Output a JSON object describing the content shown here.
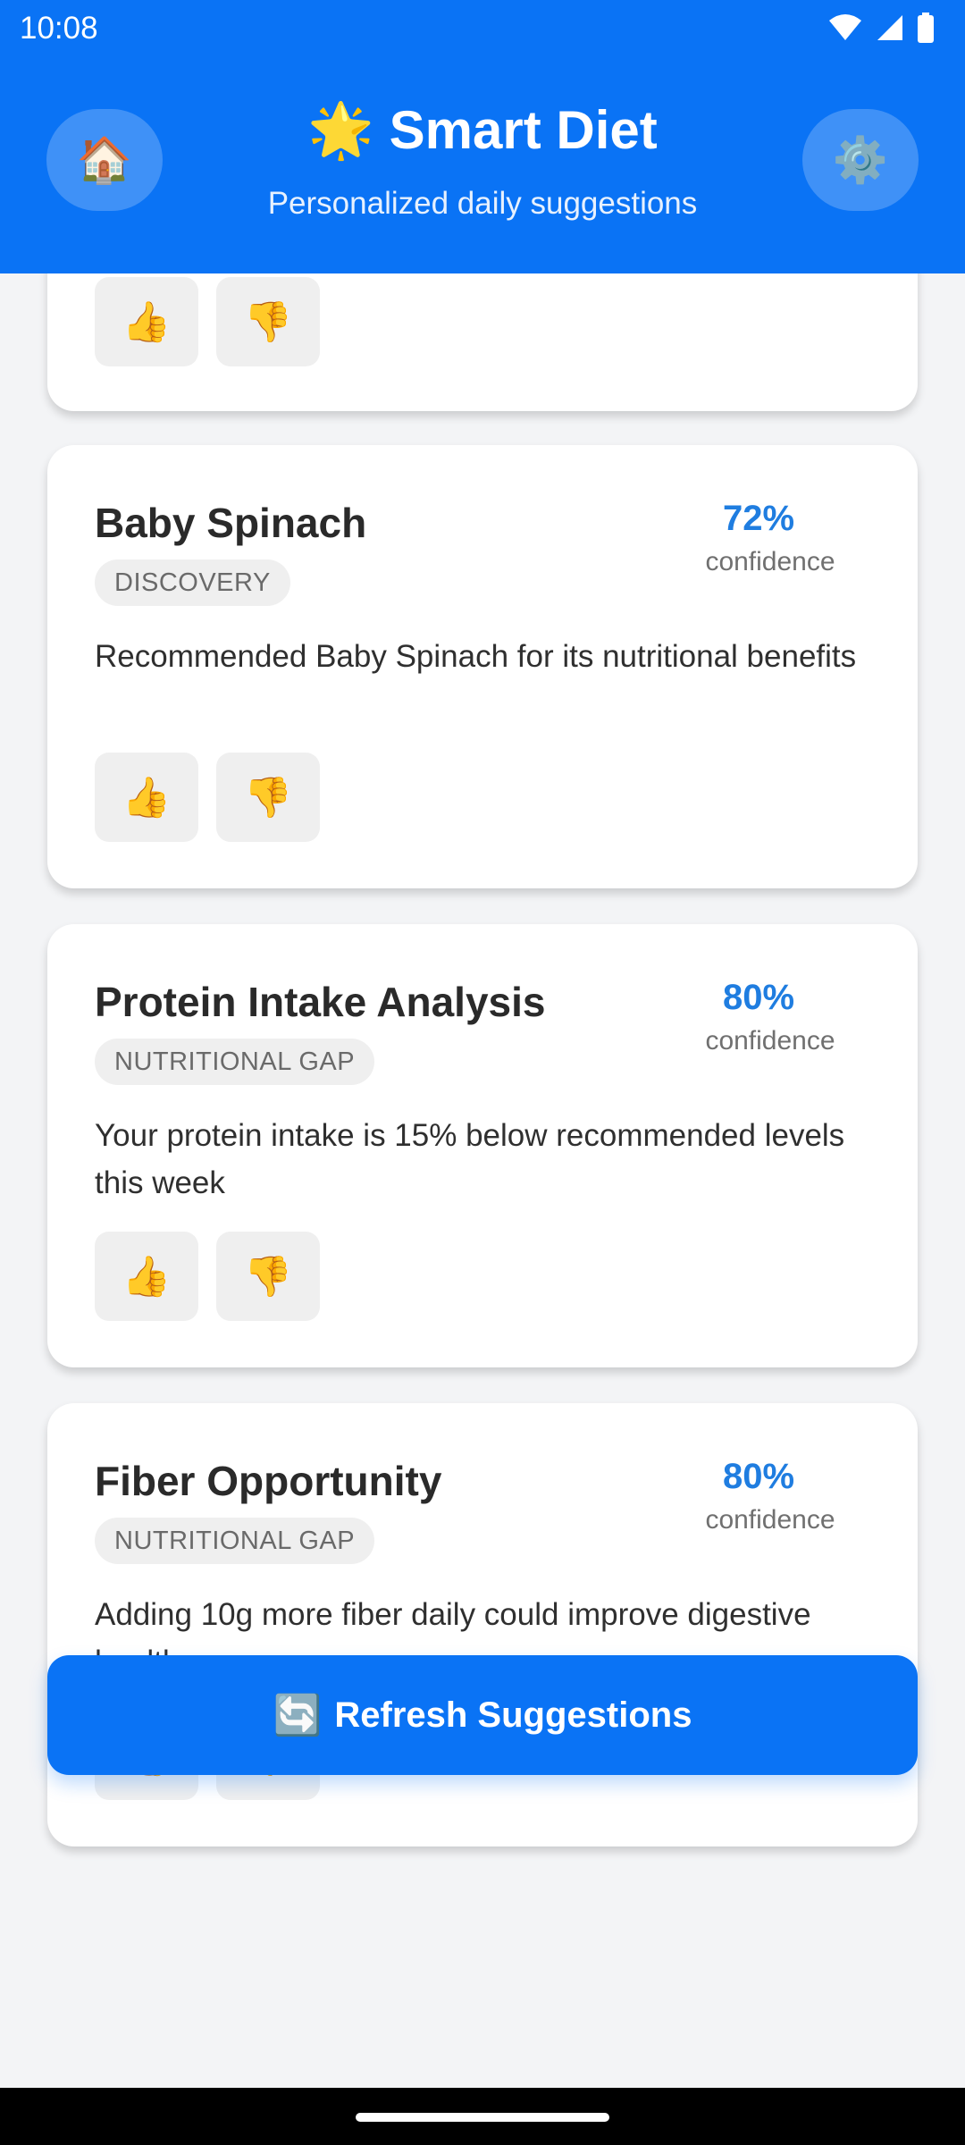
{
  "status_bar": {
    "time": "10:08",
    "icons": [
      "wifi-icon",
      "signal-icon",
      "battery-icon"
    ]
  },
  "header": {
    "title_icon": "🌟",
    "title": "Smart Diet",
    "subtitle": "Personalized daily suggestions",
    "home_icon": "🏠",
    "settings_icon": "⚙️"
  },
  "vote": {
    "up": "👍",
    "down": "👎"
  },
  "cards": [
    {
      "title": "",
      "badge": "",
      "confidence": "",
      "confidence_label": "",
      "description": ""
    },
    {
      "title": "Baby Spinach",
      "badge": "DISCOVERY",
      "confidence": "72%",
      "confidence_label": "confidence",
      "description": "Recommended Baby Spinach for its nutritional benefits"
    },
    {
      "title": "Protein Intake Analysis",
      "badge": "NUTRITIONAL GAP",
      "confidence": "80%",
      "confidence_label": "confidence",
      "description": "Your protein intake is 15% below recommended levels this week"
    },
    {
      "title": "Fiber Opportunity",
      "badge": "NUTRITIONAL GAP",
      "confidence": "80%",
      "confidence_label": "confidence",
      "description": "Adding 10g more fiber daily could improve digestive health"
    }
  ],
  "refresh": {
    "icon": "🔄",
    "label": "Refresh Suggestions"
  },
  "colors": {
    "primary": "#0a73f5",
    "accent": "#1f7de0",
    "background": "#f3f4f6"
  }
}
